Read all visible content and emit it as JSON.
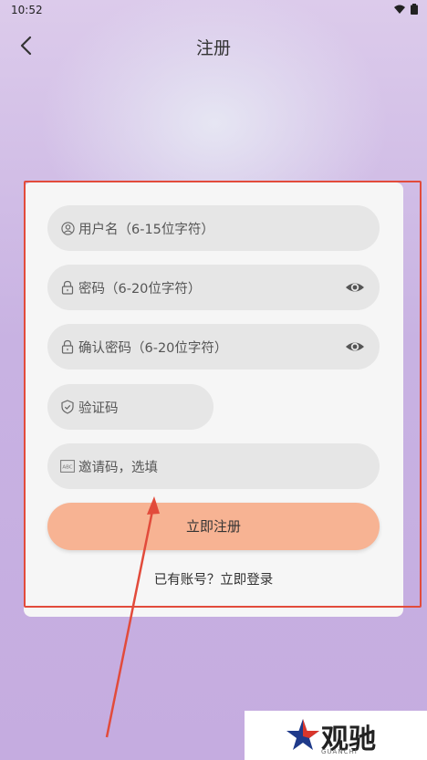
{
  "status_bar": {
    "time": "10:52",
    "icons": [
      "wifi-icon",
      "battery-icon"
    ]
  },
  "header": {
    "title": "注册",
    "back_icon": "chevron-left-icon"
  },
  "form": {
    "username_placeholder": "用户名（6-15位字符）",
    "password_placeholder": "密码（6-20位字符）",
    "confirm_placeholder": "确认密码（6-20位字符）",
    "captcha_placeholder": "验证码",
    "invite_placeholder": "邀请码，选填",
    "submit_label": "立即注册",
    "login_link": "已有账号？立即登录"
  },
  "annotation": {
    "color": "#e24b3b"
  },
  "watermark": {
    "text": "观驰",
    "sub": "GUANCHI"
  },
  "colors": {
    "primary_button": "#f7b393",
    "field_bg": "#e6e6e6",
    "card_bg": "#f6f6f6"
  }
}
